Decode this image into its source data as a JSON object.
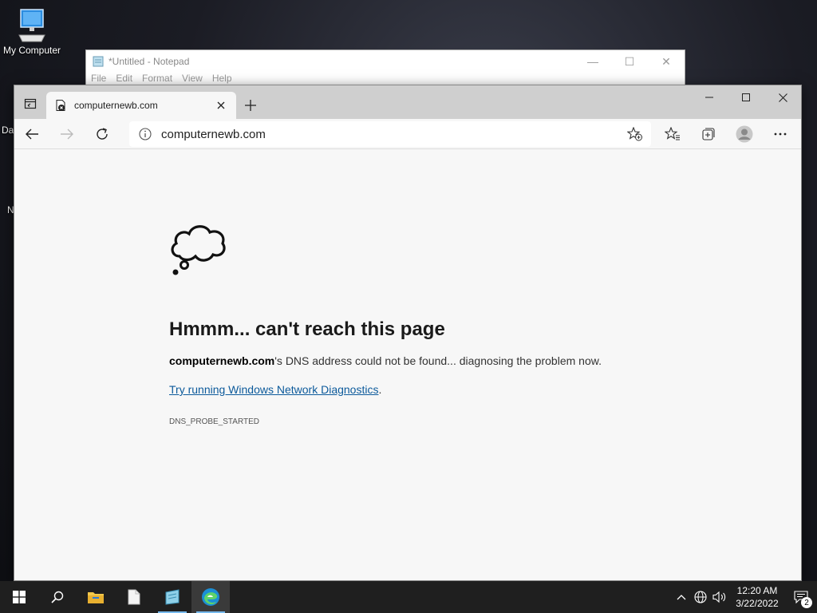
{
  "desktop": {
    "my_computer_label": "My Computer",
    "fragment_a": "Da",
    "fragment_b": "N"
  },
  "notepad": {
    "title": "*Untitled - Notepad",
    "menu": [
      "File",
      "Edit",
      "Format",
      "View",
      "Help"
    ]
  },
  "browser": {
    "tab_title": "computernewb.com",
    "address": "computernewb.com",
    "error": {
      "heading": "Hmmm... can't reach this page",
      "domain": "computernewb.com",
      "desc_rest": "'s DNS address could not be found... diagnosing the problem now.",
      "link_text": "Try running Windows Network Diagnostics",
      "link_suffix": ".",
      "code": "DNS_PROBE_STARTED"
    }
  },
  "taskbar": {
    "time": "12:20 AM",
    "date": "3/22/2022",
    "notification_count": "2"
  },
  "colors": {
    "accent": "#0c5a9b",
    "taskbar": "#1f1f1f",
    "tab_bar": "#cfcfcf"
  }
}
